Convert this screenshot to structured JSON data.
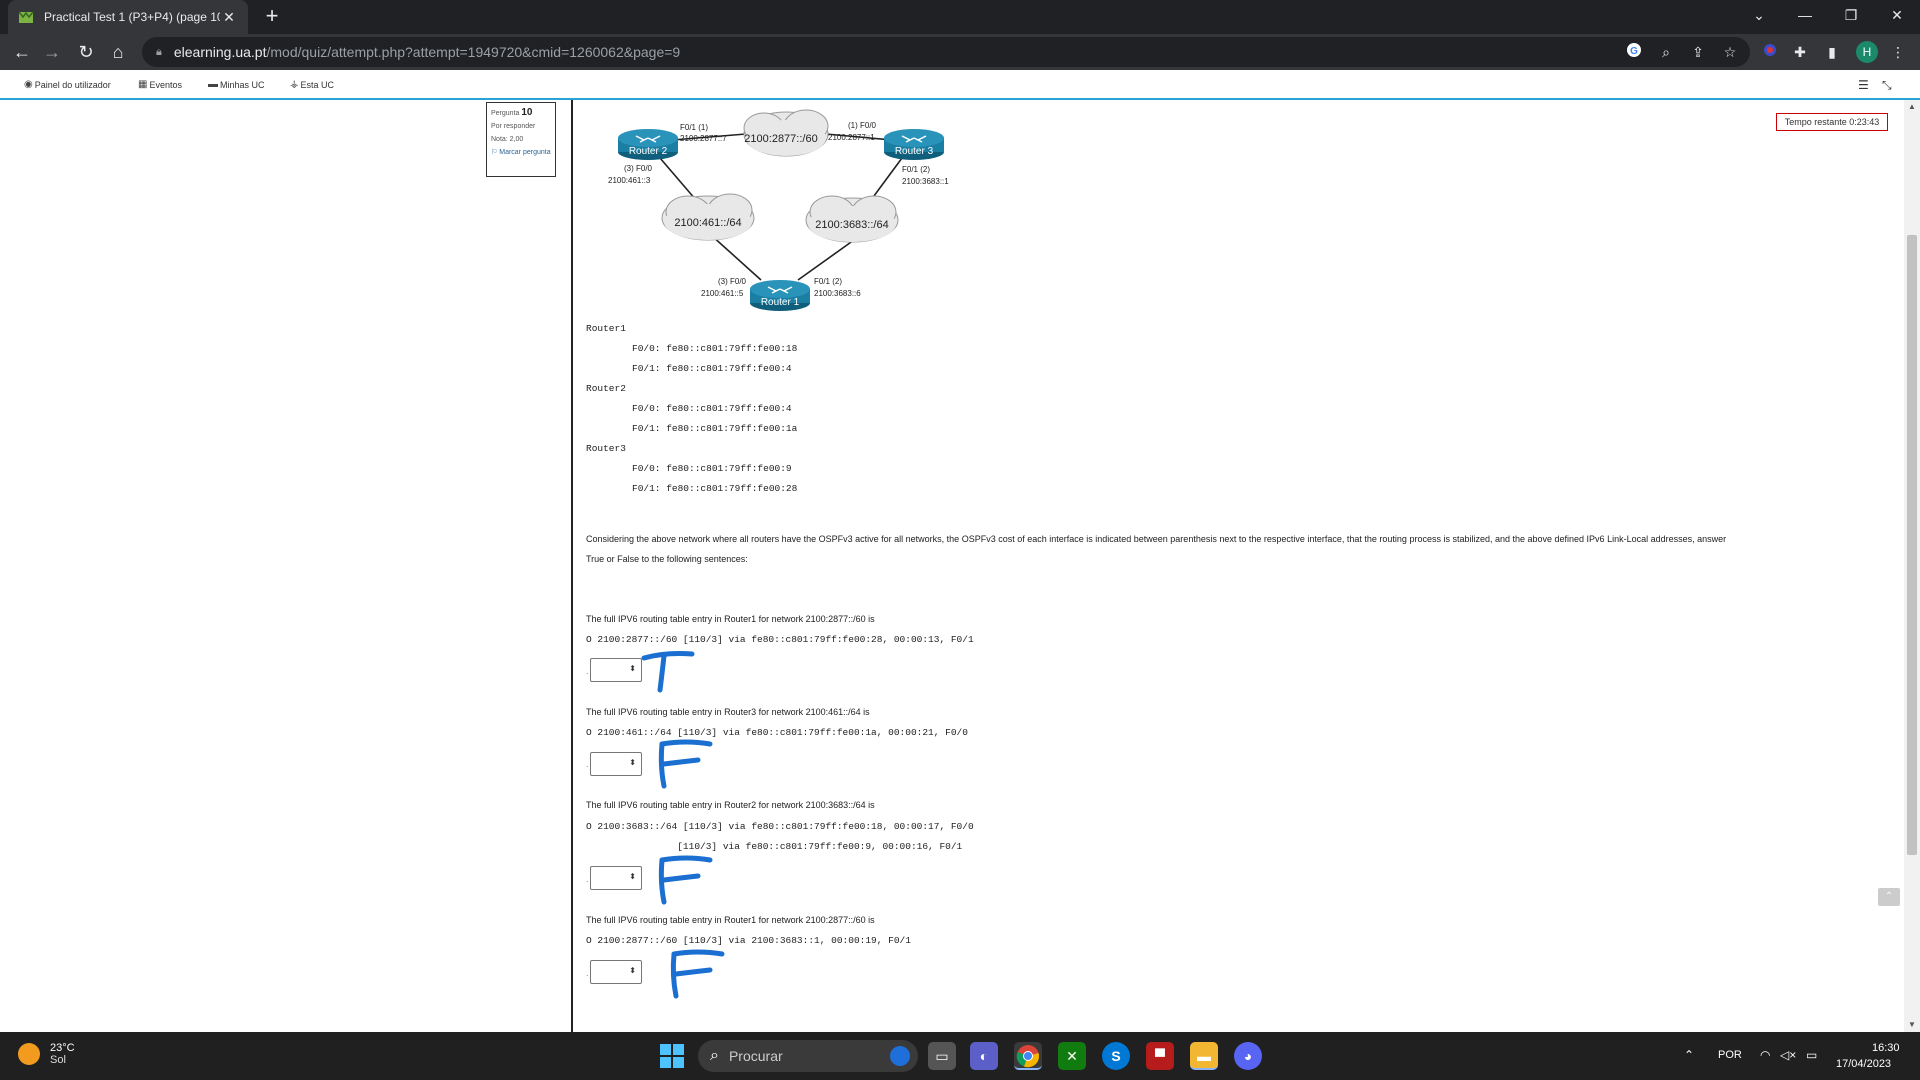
{
  "browser": {
    "tab_title": "Practical Test 1 (P3+P4) (page 10",
    "tab_close": "✕",
    "new_tab": "+",
    "url_host": "elearning.ua.pt",
    "url_path": "/mod/quiz/attempt.php?attempt=1949720&cmid=1260062&page=9",
    "profile_initial": "H",
    "win_minimize": "—",
    "win_restore": "❐",
    "win_close": "✕",
    "tab_list": "⌄"
  },
  "moodle_nav": {
    "items": [
      {
        "label": "Painel do utilizador",
        "icon": "dashboard-icon"
      },
      {
        "label": "Eventos",
        "icon": "calendar-icon"
      },
      {
        "label": "Minhas UC",
        "icon": "courses-icon"
      },
      {
        "label": "Esta UC",
        "icon": "sitemap-icon"
      }
    ]
  },
  "question_info": {
    "label": "Pergunta",
    "number": "10",
    "status": "Por responder",
    "grade": "Nota: 2,00",
    "flag": "Marcar pergunta"
  },
  "timer": "Tempo restante 0:23:43",
  "diagram": {
    "routers": [
      {
        "name": "Router 2"
      },
      {
        "name": "Router 3"
      },
      {
        "name": "Router 1"
      }
    ],
    "networks": [
      "2100:2877::/60",
      "2100:461::/64",
      "2100:3683::/64"
    ],
    "labels": {
      "r2_f01": "F0/1  (1)",
      "r2_f01_addr": "2100:2877::7",
      "r2_f00": "(3) F0/0",
      "r2_f00_addr": "2100:461::3",
      "r3_f00": "(1) F0/0",
      "r3_f00_addr": "2100:2877::1",
      "r3_f01": "F0/1  (2)",
      "r3_f01_addr": "2100:3683::1",
      "r1_f00": "(3) F0/0",
      "r1_f00_addr": "2100:461::5",
      "r1_f01": "F0/1  (2)",
      "r1_f01_addr": "2100:3683::6"
    }
  },
  "link_local": [
    {
      "router": "Router1",
      "f00": "F0/0: fe80::c801:79ff:fe00:18",
      "f01": "F0/1: fe80::c801:79ff:fe00:4"
    },
    {
      "router": "Router2",
      "f00": "F0/0: fe80::c801:79ff:fe00:4",
      "f01": "F0/1: fe80::c801:79ff:fe00:1a"
    },
    {
      "router": "Router3",
      "f00": "F0/0: fe80::c801:79ff:fe00:9",
      "f01": "F0/1: fe80::c801:79ff:fe00:28"
    }
  ],
  "question_text_1": "Considering the above network where all routers have the OSPFv3 active for all networks, the OSPFv3 cost of each interface is indicated between parenthesis next to the respective interface, that the routing process is stabilized, and the above defined IPv6 Link-Local addresses, answer",
  "question_text_2": "True or False to the following sentences:",
  "items": [
    {
      "prompt": "The full IPV6 routing table entry in Router1 for network 2100:2877::/60 is",
      "entry": "O 2100:2877::/60 [110/3] via fe80::c801:79ff:fe00:28, 00:00:13, F0/1",
      "entry2": "",
      "handwritten": "T"
    },
    {
      "prompt": "The full IPV6 routing table entry in Router3 for network 2100:461::/64 is",
      "entry": "O 2100:461::/64 [110/3] via fe80::c801:79ff:fe00:1a, 00:00:21, F0/0",
      "entry2": "",
      "handwritten": "F"
    },
    {
      "prompt": "The full IPV6 routing table entry in Router2 for network 2100:3683::/64 is",
      "entry": "O 2100:3683::/64 [110/3] via fe80::c801:79ff:fe00:18, 00:00:17, F0/0",
      "entry2": "                [110/3] via fe80::c801:79ff:fe00:9, 00:00:16, F0/1",
      "handwritten": "F"
    },
    {
      "prompt": "The full IPV6 routing table entry in Router1 for network 2100:2877::/60 is",
      "entry": "O 2100:2877::/60 [110/3] via 2100:3683::1, 00:00:19, F0/1",
      "entry2": "",
      "handwritten": "F"
    }
  ],
  "taskbar": {
    "temp": "23°C",
    "weather": "Sol",
    "search_placeholder": "Procurar",
    "lang": "POR",
    "time": "16:30",
    "date": "17/04/2023"
  },
  "colors": {
    "ink": "#1a6fd1",
    "cisco": "#1b7ea3",
    "timer_border": "#cc0000"
  }
}
